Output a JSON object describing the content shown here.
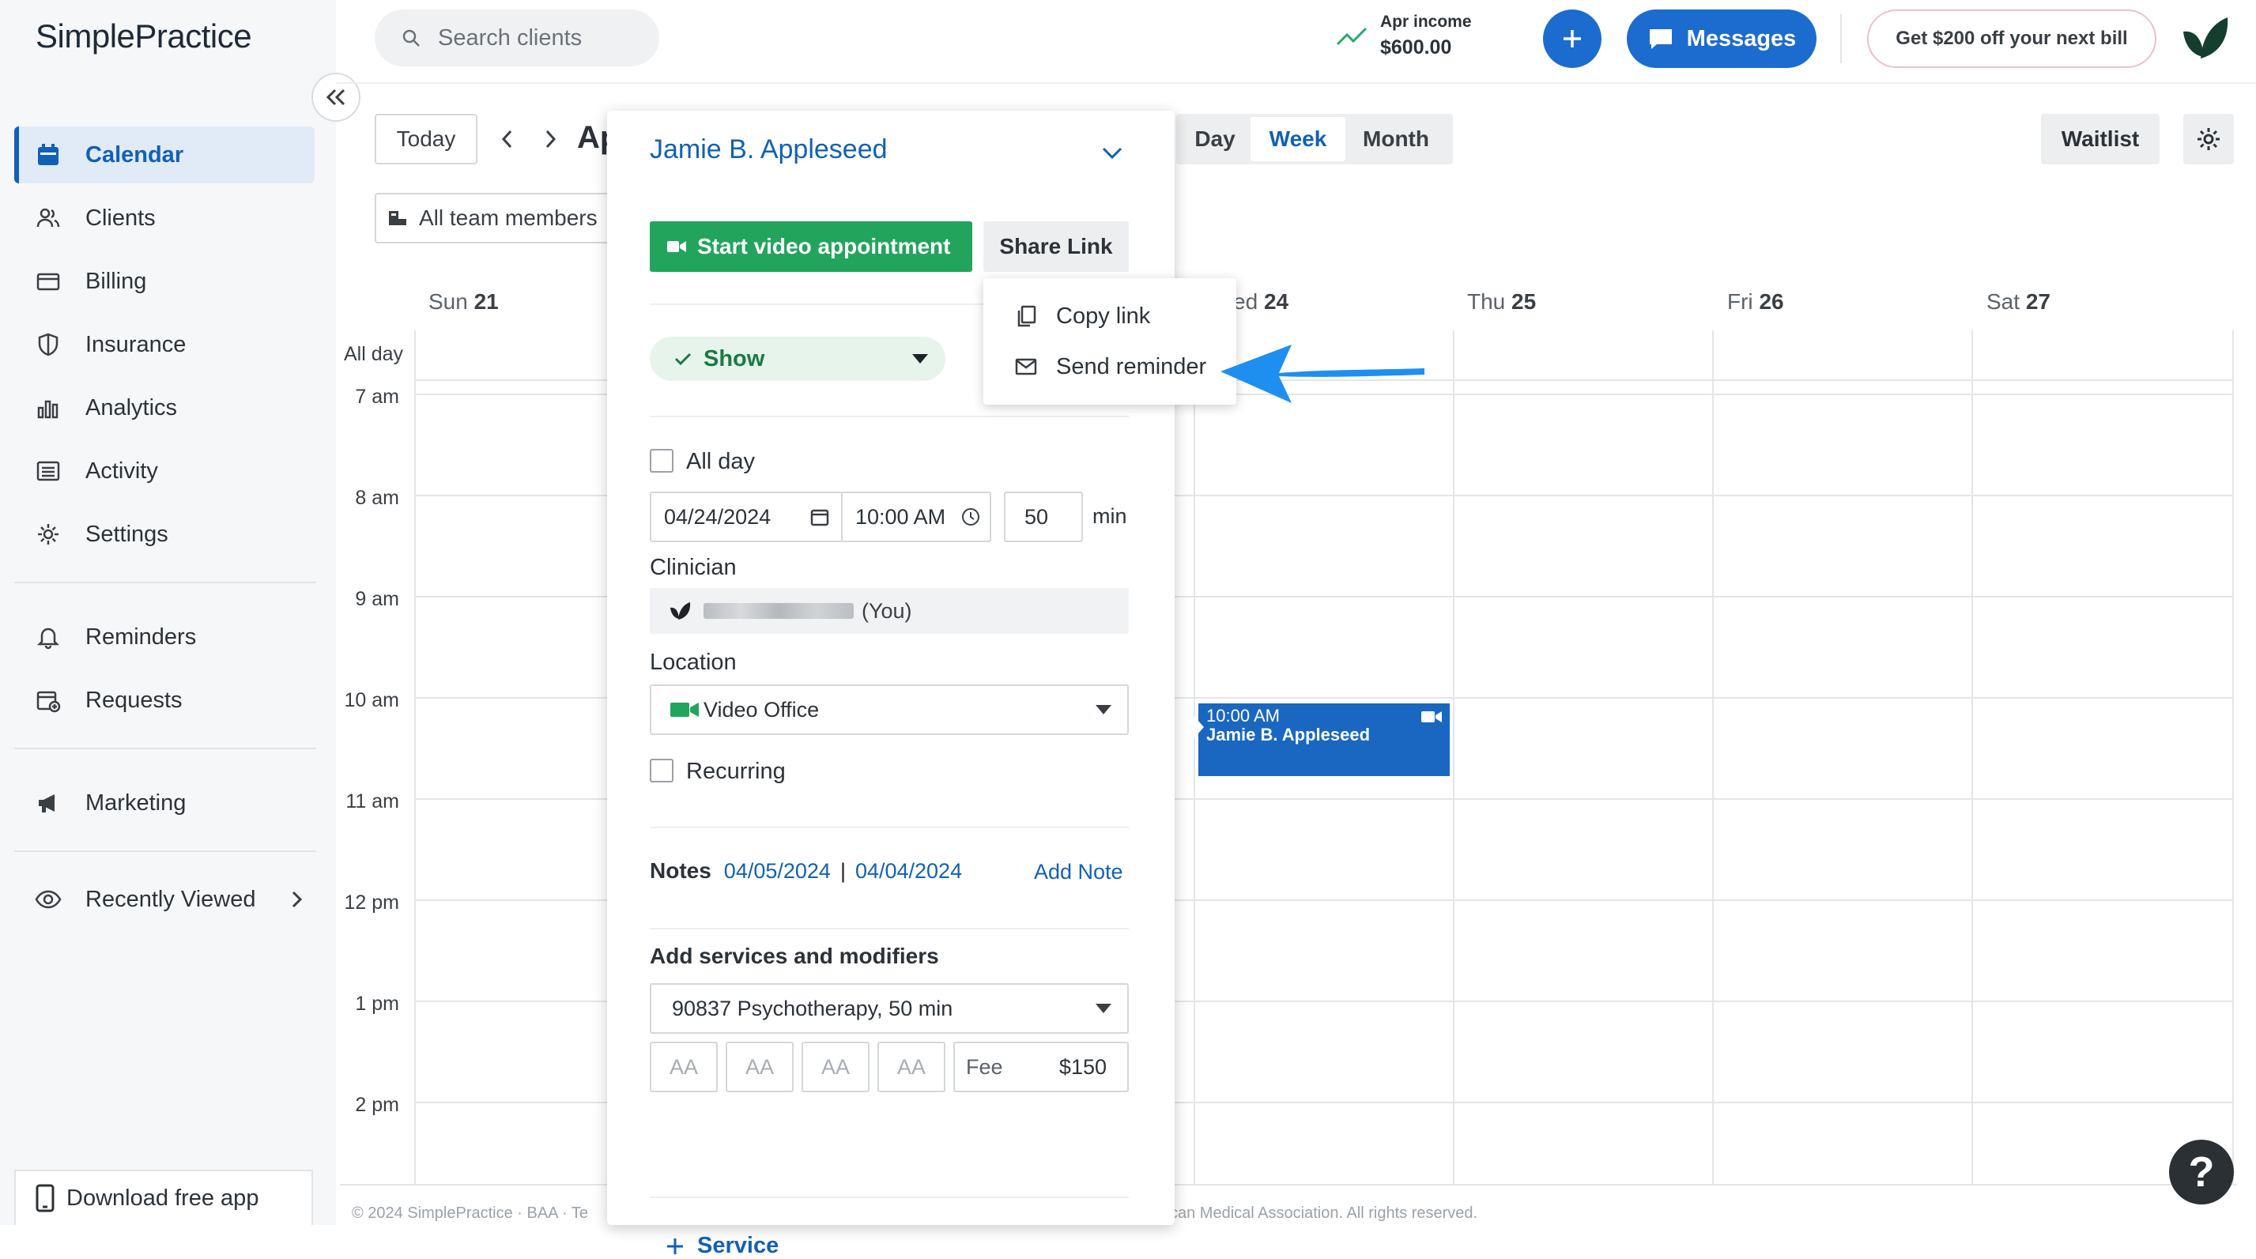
{
  "brand": {
    "logo_text": "SimplePractice"
  },
  "sidebar": {
    "items": [
      {
        "label": "Calendar",
        "icon": "calendar-icon"
      },
      {
        "label": "Clients",
        "icon": "clients-icon"
      },
      {
        "label": "Billing",
        "icon": "billing-icon"
      },
      {
        "label": "Insurance",
        "icon": "shield-icon"
      },
      {
        "label": "Analytics",
        "icon": "bar-chart-icon"
      },
      {
        "label": "Activity",
        "icon": "list-icon"
      },
      {
        "label": "Settings",
        "icon": "gear-icon"
      },
      {
        "label": "Reminders",
        "icon": "bell-icon"
      },
      {
        "label": "Requests",
        "icon": "calendar-plus-icon"
      },
      {
        "label": "Marketing",
        "icon": "megaphone-icon"
      },
      {
        "label": "Recently Viewed",
        "icon": "eye-icon"
      }
    ],
    "download_label": "Download free app"
  },
  "topbar": {
    "search_placeholder": "Search clients",
    "income_label": "Apr income",
    "income_value": "$600.00",
    "messages_label": "Messages",
    "promo_label": "Get $200 off your next bill"
  },
  "toolbar": {
    "today_label": "Today",
    "month_partial": "Ap",
    "views": [
      "Day",
      "Week",
      "Month"
    ],
    "active_view": "Week",
    "waitlist_label": "Waitlist",
    "team_filter": "All team members"
  },
  "calendar": {
    "days": [
      {
        "name": "Sun",
        "num": "21"
      },
      {
        "name": "ed",
        "num": "24"
      },
      {
        "name": "Thu",
        "num": "25"
      },
      {
        "name": "Fri",
        "num": "26"
      },
      {
        "name": "Sat",
        "num": "27"
      }
    ],
    "all_day_label": "All day",
    "times": [
      "7 am",
      "8 am",
      "9 am",
      "10 am",
      "11 am",
      "12 pm",
      "1 pm",
      "2 pm"
    ],
    "event": {
      "time": "10:00 AM",
      "client": "Jamie B. Appleseed"
    },
    "footer_left": "© 2024 SimplePractice · BAA · Te",
    "footer_right": "can Medical Association. All rights reserved.",
    "help_label": "?"
  },
  "appointment": {
    "client_name": "Jamie B. Appleseed",
    "video_button": "Start video appointment",
    "share_button": "Share Link",
    "status": "Show",
    "all_day_label": "All day",
    "date": "04/24/2024",
    "time": "10:00 AM",
    "duration": "50",
    "duration_unit": "min",
    "clinician_label": "Clinician",
    "clinician_you": "(You)",
    "location_label": "Location",
    "location_value": "Video Office",
    "recurring_label": "Recurring",
    "notes_label": "Notes",
    "note_dates": [
      "04/05/2024",
      "04/04/2024"
    ],
    "note_separator": "|",
    "add_note": "Add Note",
    "services_label": "Add services and modifiers",
    "service_value": "90837 Psychotherapy, 50 min",
    "modifiers": [
      "AA",
      "AA",
      "AA",
      "AA"
    ],
    "fee_label": "Fee",
    "fee_value": "$150",
    "add_service": "Service"
  },
  "share_menu": {
    "items": [
      "Copy link",
      "Send reminder"
    ]
  },
  "colors": {
    "accent": "#1160b7",
    "primary_button": "#1c6cd0",
    "video_green": "#22a45d",
    "event_blue": "#1967c0",
    "arrow_blue": "#1e8ff0"
  }
}
